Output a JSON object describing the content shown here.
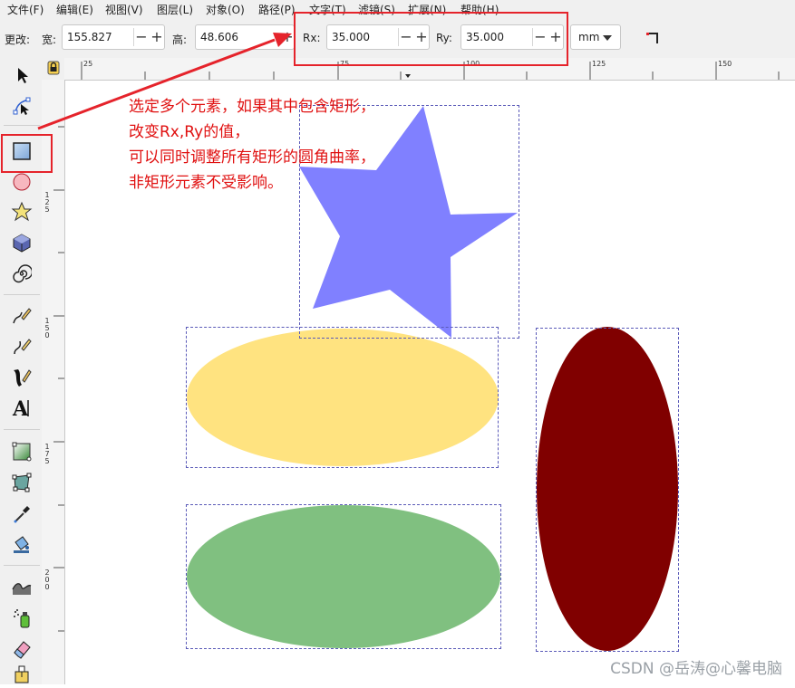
{
  "menubar": {
    "items": [
      "文件(F)",
      "编辑(E)",
      "视图(V)",
      "图层(L)",
      "对象(O)",
      "路径(P)",
      "文字(T)",
      "滤镜(S)",
      "扩展(N)",
      "帮助(H)"
    ]
  },
  "toolbar": {
    "change_label": "更改:",
    "width_label": "宽:",
    "width_value": "155.827",
    "height_label": "高:",
    "height_value": "48.606",
    "rx_label": "Rx:",
    "rx_value": "35.000",
    "ry_label": "Ry:",
    "ry_value": "35.000",
    "unit": "mm",
    "minus": "−",
    "plus": "+"
  },
  "rulers": {
    "horizontal": [
      "25",
      "75",
      "100",
      "125",
      "150"
    ],
    "vertical": [
      [
        "1",
        "2",
        "5"
      ],
      [
        "1",
        "5",
        "0"
      ],
      [
        "1",
        "7",
        "5"
      ],
      [
        "2",
        "0",
        "0"
      ]
    ]
  },
  "toolbox": {
    "tools": [
      "selector-tool",
      "node-tool",
      "rectangle-tool",
      "ellipse-tool",
      "star-tool",
      "3d-box-tool",
      "spiral-tool",
      "pencil-tool",
      "pen-tool",
      "calligraphy-tool",
      "text-tool",
      "gradient-tool",
      "mesh-tool",
      "dropper-tool",
      "paint-bucket-tool",
      "tweak-tool",
      "spray-tool",
      "eraser-tool",
      "connector-tool"
    ]
  },
  "annotation": {
    "lines": [
      "选定多个元素，如果其中包含矩形，",
      "改变Rx,Ry的值，",
      "可以同时调整所有矩形的圆角曲率，",
      "非矩形元素不受影响。"
    ]
  },
  "colors": {
    "star": "#8080ff",
    "yellow_ellipse": "#ffe380",
    "green_ellipse": "#80c080",
    "dark_red_ellipse": "#800000",
    "annotation_red": "#e5232b"
  },
  "watermark": "CSDN @岳涛@心馨电脑"
}
